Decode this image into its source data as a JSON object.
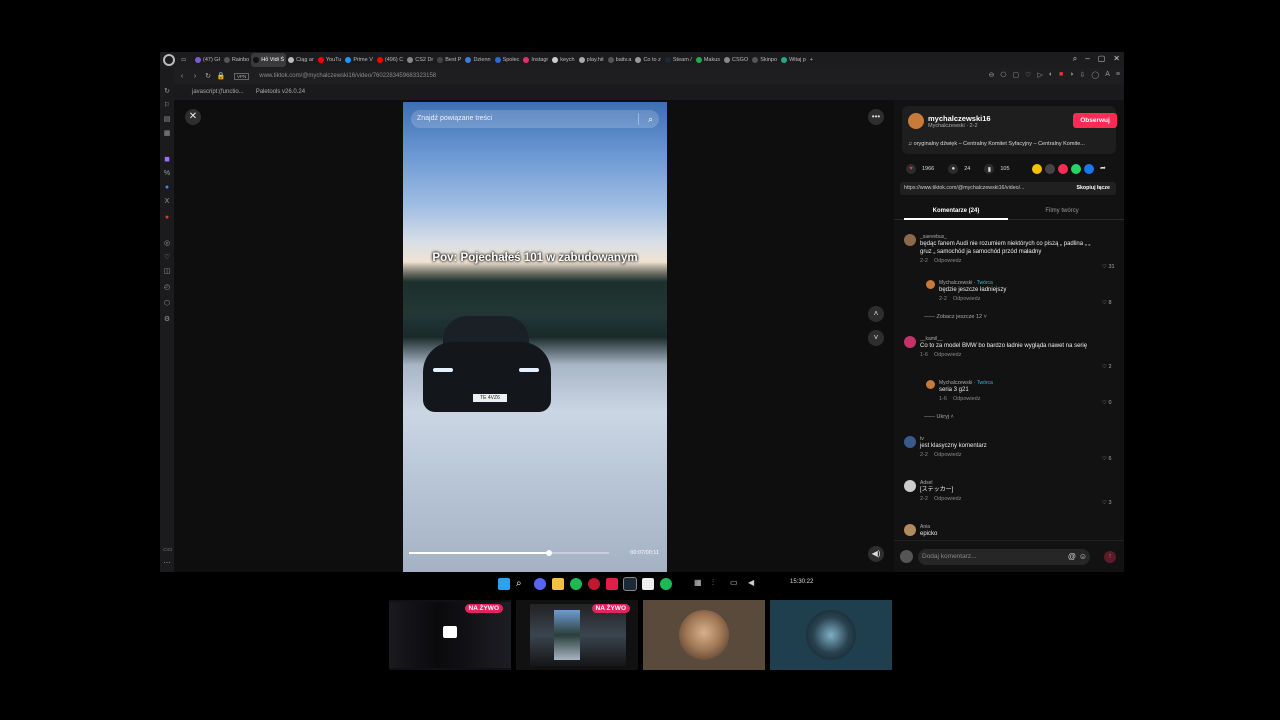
{
  "browser": {
    "tabs": [
      {
        "label": "(47) Gł",
        "color": "#7b5cd6"
      },
      {
        "label": "Rainbo",
        "color": "#555"
      },
      {
        "label": "Hỏ Vidi Ś",
        "color": "#111",
        "active": true
      },
      {
        "label": "Ciąg ar",
        "color": "#bbb"
      },
      {
        "label": "YouTu",
        "color": "#ff0000"
      },
      {
        "label": "Prime V",
        "color": "#1a98ff"
      },
      {
        "label": "(496) C",
        "color": "#ff0000"
      },
      {
        "label": "CS2 Dr",
        "color": "#888"
      },
      {
        "label": "Best P",
        "color": "#444"
      },
      {
        "label": "Dzienn",
        "color": "#3b7dd8"
      },
      {
        "label": "Społec",
        "color": "#2b6bd6"
      },
      {
        "label": "Instagr",
        "color": "#e1306c"
      },
      {
        "label": "keych",
        "color": "#ccc"
      },
      {
        "label": "play.hit",
        "color": "#aaa"
      },
      {
        "label": "baitv.a",
        "color": "#555"
      },
      {
        "label": "Co to z",
        "color": "#999"
      },
      {
        "label": "Steam /",
        "color": "#1b2838"
      },
      {
        "label": "Makus",
        "color": "#22aa55"
      },
      {
        "label": "CSGO",
        "color": "#888"
      },
      {
        "label": "Skinpo",
        "color": "#555"
      },
      {
        "label": "Witaj p",
        "color": "#2a8"
      }
    ],
    "url": "www.tiktok.com/@mychalczewski16/video/7602283459683323158",
    "vpn_label": "VPN",
    "bookmarks": [
      "javascript:(functio...",
      "Paletools v26.0.24"
    ]
  },
  "video": {
    "search_placeholder": "Znajdź powiązane treści",
    "caption": "Pov: Pojechałeś 101 w zabudowanym",
    "plate": "TE 4VZ6",
    "timecode": "00:07/00:11",
    "progress": 0.7
  },
  "creator": {
    "username": "mychalczewski16",
    "subline": "Mychalczewski · 2-2",
    "follow_label": "Obserwuj",
    "music": "oryginalny dźwięk – Centralny Komitet Syfacyjny – Centralny Komite..."
  },
  "stats": {
    "likes": "1966",
    "comments": "24",
    "saves": "105"
  },
  "share_colors": [
    "#f2c200",
    "#444444",
    "#fe2c55",
    "#25d366",
    "#1877f2"
  ],
  "link": {
    "text": "https://www.tiktok.com/@mychalczewski16/video/...",
    "copy_label": "Skopiuj łącze"
  },
  "panel_tabs": {
    "comments": "Komentarze (24)",
    "creator_videos": "Filmy twórcy"
  },
  "comments": [
    {
      "user": "_saevebus_",
      "text": "będąc fanem Audi nie rozumiem niektórych co piszą „ padlina „ „ gruz „ samochód ja samochód przód maładny",
      "date": "2-2",
      "reply": "Odpowiedz",
      "likes": "31"
    },
    {
      "user": "Mychalczewski",
      "badge": "Twórca",
      "text": "będzie jeszcze ładniejszy",
      "date": "2-2",
      "reply": "Odpowiedz",
      "likes": "8"
    },
    {
      "more": "Zobacz jeszcze 12"
    },
    {
      "user": "__kamil__",
      "text": "Co to za model BMW bo bardzo ładnie wygląda nawet na serię",
      "date": "1-6",
      "reply": "Odpowiedz",
      "likes": "2"
    },
    {
      "user": "Mychalczewski",
      "badge": "Twórca",
      "text": "seria 3 g21",
      "date": "1-6",
      "reply": "Odpowiedz",
      "likes": "0"
    },
    {
      "more": "Ukryj"
    },
    {
      "user": "tv",
      "text": "jest klasyczny komentarz",
      "date": "2-2",
      "reply": "Odpowiedz",
      "likes": "6"
    },
    {
      "user": "Adsel",
      "text": "[ステッカー]",
      "date": "2-2",
      "reply": "Odpowiedz",
      "likes": "3"
    },
    {
      "user": "Ania",
      "text": "epicko",
      "date": "",
      "reply": "",
      "likes": ""
    }
  ],
  "comment_input": {
    "placeholder": "Dodaj komentarz..."
  },
  "taskbar": {
    "clock": "15:30:22"
  },
  "participants": [
    {
      "label": "NA ŻYWO"
    },
    {
      "label": "NA ŻYWO"
    }
  ]
}
